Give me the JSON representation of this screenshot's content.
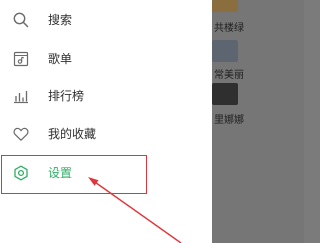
{
  "menu": {
    "items": [
      {
        "label": "搜索",
        "icon": "search-icon"
      },
      {
        "label": "歌单",
        "icon": "playlist-icon"
      },
      {
        "label": "排行榜",
        "icon": "chart-icon"
      },
      {
        "label": "我的收藏",
        "icon": "heart-icon"
      },
      {
        "label": "设置",
        "icon": "settings-icon",
        "active": true
      }
    ]
  },
  "background": {
    "texts": [
      "共楼绿",
      "常美丽",
      "里娜娜"
    ]
  },
  "colors": {
    "accent": "#2eaf64",
    "icon": "#6a6a6a",
    "annotation": "#e2343a",
    "overlay": "#7b7b7b"
  }
}
